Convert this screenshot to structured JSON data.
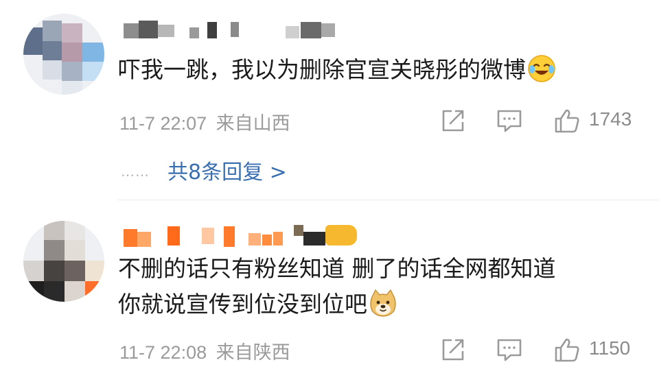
{
  "comments": [
    {
      "text": "吓我一跳，我以为删除官宣关晓彤的微博",
      "emoji": "laugh-cry-emoji",
      "time": "11-7 22:07",
      "location": "来自山西",
      "likes": "1743",
      "replies_label": "共8条回复 >",
      "replies_dots": "……"
    },
    {
      "text_line1": "不删的话只有粉丝知道 删了的话全网都知道",
      "text_line2": "你就说宣传到位没到位吧",
      "emoji": "doge-emoji",
      "time": "11-7 22:08",
      "location": "来自陕西",
      "likes": "1150",
      "badge_color": "#f5b82e"
    }
  ],
  "colors": {
    "link": "#3a6fb0",
    "meta": "#9a9a9a",
    "text": "#1a1a1a",
    "username_mosaic_1": [
      "#6f6f6f",
      "#c9c9c9",
      "#3d3d3d",
      "#a0a0a0"
    ],
    "username_mosaic_2": [
      "#ff6a1a",
      "#ffb27a",
      "#ff8c3c",
      "#2b2b2b"
    ]
  }
}
